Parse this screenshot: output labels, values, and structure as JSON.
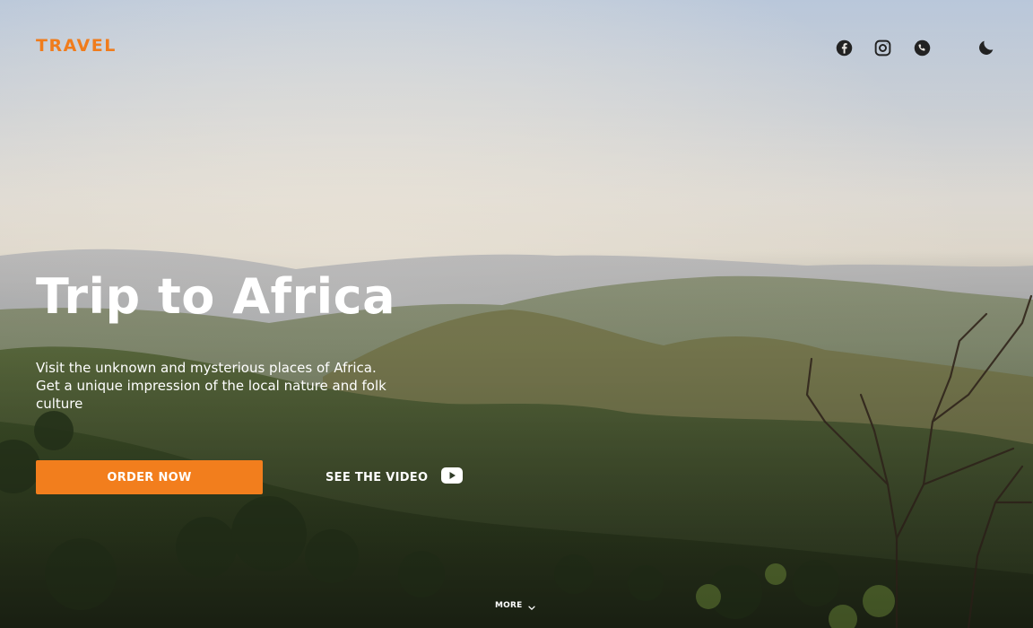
{
  "brand": {
    "name": "TRAVEL"
  },
  "header": {
    "social_icons": [
      "facebook-icon",
      "instagram-icon",
      "phone-icon"
    ],
    "theme_toggle_icon": "moon-icon"
  },
  "hero": {
    "title": "Trip to Africa",
    "subtitle_lines": [
      "Visit the unknown and mysterious places of Africa.",
      "Get a unique impression of the local nature and folk",
      "culture"
    ],
    "primary_button": "ORDER NOW",
    "video_link": "SEE THE VIDEO",
    "video_icon": "youtube-play-icon"
  },
  "footer": {
    "more_label": "MORE",
    "more_icon": "chevron-down-icon"
  },
  "colors": {
    "accent": "#f27e1d",
    "brand": "#f07c1c",
    "text": "#ffffff",
    "icon": "#222222"
  }
}
